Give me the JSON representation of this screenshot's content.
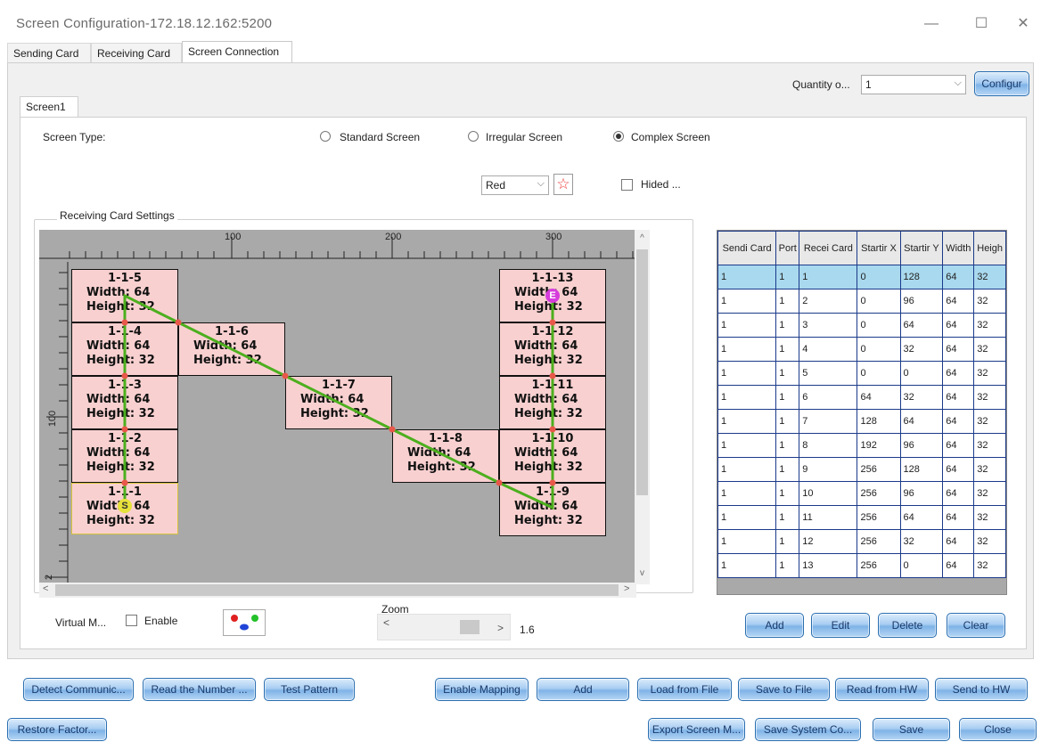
{
  "window": {
    "title": "Screen Configuration-172.18.12.162:5200",
    "minimize": "—",
    "maximize": "☐",
    "close": "✕"
  },
  "tabs": [
    "Sending Card",
    "Receiving Card",
    "Screen Connection"
  ],
  "quantity": {
    "label": "Quantity o...",
    "value": "1",
    "configure": "Configur"
  },
  "screen_tab": "Screen1",
  "screen_type": {
    "label": "Screen Type:",
    "options": [
      "Standard Screen",
      "Irregular Screen",
      "Complex Screen"
    ],
    "selected": "Complex Screen"
  },
  "color_select": "Red",
  "hided_label": "Hided ...",
  "group_title": "Receiving Card Settings",
  "ruler": {
    "top": [
      "100",
      "200",
      "300"
    ],
    "left": [
      "100",
      "2"
    ]
  },
  "cells": [
    {
      "id": "1-1-5",
      "w": "Width: 64",
      "h": "Height: 32"
    },
    {
      "id": "1-1-4",
      "w": "Width: 64",
      "h": "Height: 32"
    },
    {
      "id": "1-1-3",
      "w": "Width: 64",
      "h": "Height: 32"
    },
    {
      "id": "1-1-2",
      "w": "Width: 64",
      "h": "Height: 32"
    },
    {
      "id": "1-1-1",
      "w": "Width: 64",
      "h": "Height: 32"
    },
    {
      "id": "1-1-6",
      "w": "Width: 64",
      "h": "Height: 32"
    },
    {
      "id": "1-1-7",
      "w": "Width: 64",
      "h": "Height: 32"
    },
    {
      "id": "1-1-8",
      "w": "Width: 64",
      "h": "Height: 32"
    },
    {
      "id": "1-1-13",
      "w": "Width: 64",
      "h": "Height: 32"
    },
    {
      "id": "1-1-12",
      "w": "Width: 64",
      "h": "Height: 32"
    },
    {
      "id": "1-1-11",
      "w": "Width: 64",
      "h": "Height: 32"
    },
    {
      "id": "1-1-10",
      "w": "Width: 64",
      "h": "Height: 32"
    },
    {
      "id": "1-1-9",
      "w": "Width: 64",
      "h": "Height: 32"
    }
  ],
  "markers": {
    "start": "S",
    "end": "E"
  },
  "virtual": {
    "label": "Virtual M...",
    "enable": "Enable"
  },
  "zoom": {
    "label": "Zoom",
    "value": "1.6"
  },
  "table": {
    "headers": [
      "Sendi Card",
      "Port",
      "Recei Card",
      "Startir X",
      "Startir Y",
      "Width",
      "Heigh"
    ],
    "rows": [
      [
        "1",
        "1",
        "1",
        "0",
        "128",
        "64",
        "32"
      ],
      [
        "1",
        "1",
        "2",
        "0",
        "96",
        "64",
        "32"
      ],
      [
        "1",
        "1",
        "3",
        "0",
        "64",
        "64",
        "32"
      ],
      [
        "1",
        "1",
        "4",
        "0",
        "32",
        "64",
        "32"
      ],
      [
        "1",
        "1",
        "5",
        "0",
        "0",
        "64",
        "32"
      ],
      [
        "1",
        "1",
        "6",
        "64",
        "32",
        "64",
        "32"
      ],
      [
        "1",
        "1",
        "7",
        "128",
        "64",
        "64",
        "32"
      ],
      [
        "1",
        "1",
        "8",
        "192",
        "96",
        "64",
        "32"
      ],
      [
        "1",
        "1",
        "9",
        "256",
        "128",
        "64",
        "32"
      ],
      [
        "1",
        "1",
        "10",
        "256",
        "96",
        "64",
        "32"
      ],
      [
        "1",
        "1",
        "11",
        "256",
        "64",
        "64",
        "32"
      ],
      [
        "1",
        "1",
        "12",
        "256",
        "32",
        "64",
        "32"
      ],
      [
        "1",
        "1",
        "13",
        "256",
        "0",
        "64",
        "32"
      ]
    ],
    "selected_row": 0
  },
  "table_buttons": [
    "Add",
    "Edit",
    "Delete",
    "Clear"
  ],
  "bottom_row1": [
    "Detect Communic...",
    "Read the Number ...",
    "Test Pattern",
    "Enable Mapping",
    "Add",
    "Load from File",
    "Save to File",
    "Read from HW",
    "Send to HW"
  ],
  "bottom_row2": [
    "Restore Factor...",
    "Export Screen M...",
    "Save System Co...",
    "Save",
    "Close"
  ],
  "colors": {
    "accent": "#7fb3e7",
    "cell": "#f9d0d0",
    "route": "#4caf1e",
    "node": "#e8584a",
    "selected": "#a9d9ee"
  }
}
